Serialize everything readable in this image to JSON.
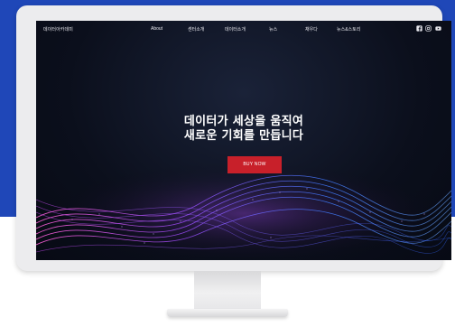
{
  "site": {
    "logo": "데이터아카데미",
    "nav": [
      {
        "label": "About"
      },
      {
        "label": "센터소개"
      },
      {
        "label": "데이터소개"
      },
      {
        "label": "뉴스"
      },
      {
        "label": "채우다"
      },
      {
        "label": "뉴스&스토리"
      }
    ],
    "social": [
      {
        "icon": "facebook-icon"
      },
      {
        "icon": "instagram-icon"
      },
      {
        "icon": "youtube-icon"
      }
    ],
    "hero": {
      "line1": "데이터가 세상을 움직여",
      "line2": "새로운 기회를 만듭니다",
      "cta_label": "BUY NOW"
    }
  },
  "colors": {
    "background_blue": "#1f47b8",
    "cta_red": "#c8202a",
    "screen_dark": "#0b0f1c",
    "wave_purple": "#a04cff",
    "wave_blue": "#3f7bff",
    "wave_pink": "#ff5fd6"
  }
}
